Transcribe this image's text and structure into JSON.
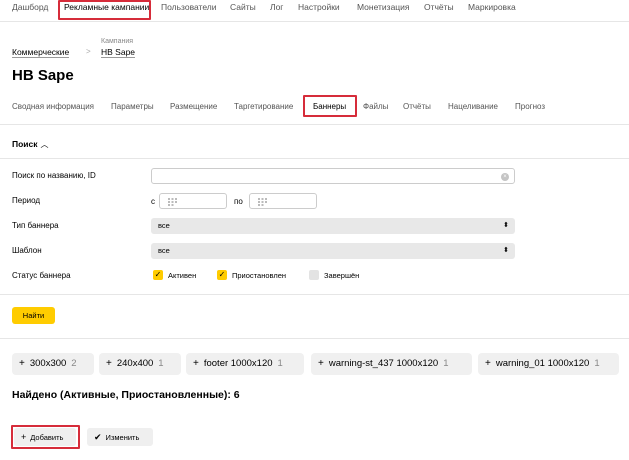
{
  "topnav": {
    "items": [
      "Дашборд",
      "Рекламные кампании",
      "Пользователи",
      "Сайты",
      "Лог",
      "Настройки",
      "Монетизация",
      "Отчёты",
      "Маркировка"
    ],
    "active": "Рекламные кампании"
  },
  "breadcrumb": {
    "first": "Коммерческие",
    "sep": ">",
    "second_label": "Кампания",
    "second": "HB Sape"
  },
  "page_title": "HB Sape",
  "tabs": {
    "items": [
      "Сводная информация",
      "Параметры",
      "Размещение",
      "Таргетирование",
      "Баннеры",
      "Файлы",
      "Отчёты",
      "Нацеливание",
      "Прогноз"
    ],
    "active": "Баннеры"
  },
  "search": {
    "toggle_label": "Поиск",
    "toggle_icon": "chevron-up-icon",
    "name_label": "Поиск по названию, ID",
    "name_value": "",
    "period_label": "Период",
    "period_from_label": "с",
    "period_to_label": "по",
    "banner_type_label": "Тип баннера",
    "banner_type_value": "все",
    "template_label": "Шаблон",
    "template_value": "все",
    "status_label": "Статус баннера",
    "statuses": [
      {
        "label": "Активен",
        "checked": true
      },
      {
        "label": "Приостановлен",
        "checked": true
      },
      {
        "label": "Завершён",
        "checked": false
      }
    ],
    "find_button": "Найти"
  },
  "colors": {
    "accent": "#ffcc00",
    "highlight": "#d62c3a"
  },
  "filters": [
    {
      "label": "300x300",
      "count": "2"
    },
    {
      "label": "240x400",
      "count": "1"
    },
    {
      "label": "footer 1000x120",
      "count": "1"
    },
    {
      "label": "warning-st_437 1000x120",
      "count": "1"
    },
    {
      "label": "warning_01 1000x120",
      "count": "1"
    }
  ],
  "found_text": "Найдено (Активные, Приостановленные): 6",
  "actions": {
    "add": "Добавить",
    "edit": "Изменить"
  }
}
